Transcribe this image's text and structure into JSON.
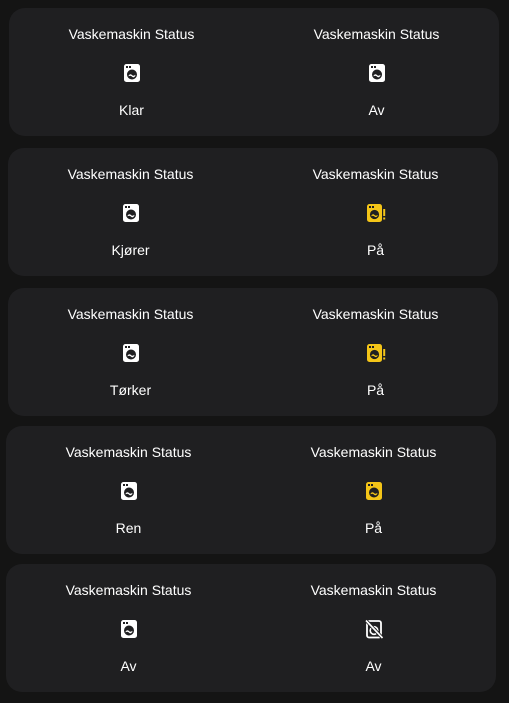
{
  "colors": {
    "active": "#f4c518",
    "idle": "#ffffff",
    "card": "#1f1f21",
    "background": "#141414"
  },
  "cards": [
    {
      "left": {
        "title": "Vaskemaskin Status",
        "state": "Klar",
        "icon": "washing-machine-icon"
      },
      "right": {
        "title": "Vaskemaskin Status",
        "state": "Av",
        "icon": "washing-machine-icon"
      }
    },
    {
      "left": {
        "title": "Vaskemaskin Status",
        "state": "Kjører",
        "icon": "washing-machine-icon"
      },
      "right": {
        "title": "Vaskemaskin Status",
        "state": "På",
        "icon": "washing-machine-alert-icon"
      }
    },
    {
      "left": {
        "title": "Vaskemaskin Status",
        "state": "Tørker",
        "icon": "washing-machine-icon"
      },
      "right": {
        "title": "Vaskemaskin Status",
        "state": "På",
        "icon": "washing-machine-alert-icon"
      }
    },
    {
      "left": {
        "title": "Vaskemaskin Status",
        "state": "Ren",
        "icon": "washing-machine-icon"
      },
      "right": {
        "title": "Vaskemaskin Status",
        "state": "På",
        "icon": "washing-machine-on-icon"
      }
    },
    {
      "left": {
        "title": "Vaskemaskin Status",
        "state": "Av",
        "icon": "washing-machine-icon"
      },
      "right": {
        "title": "Vaskemaskin Status",
        "state": "Av",
        "icon": "washing-machine-off-icon"
      }
    }
  ]
}
